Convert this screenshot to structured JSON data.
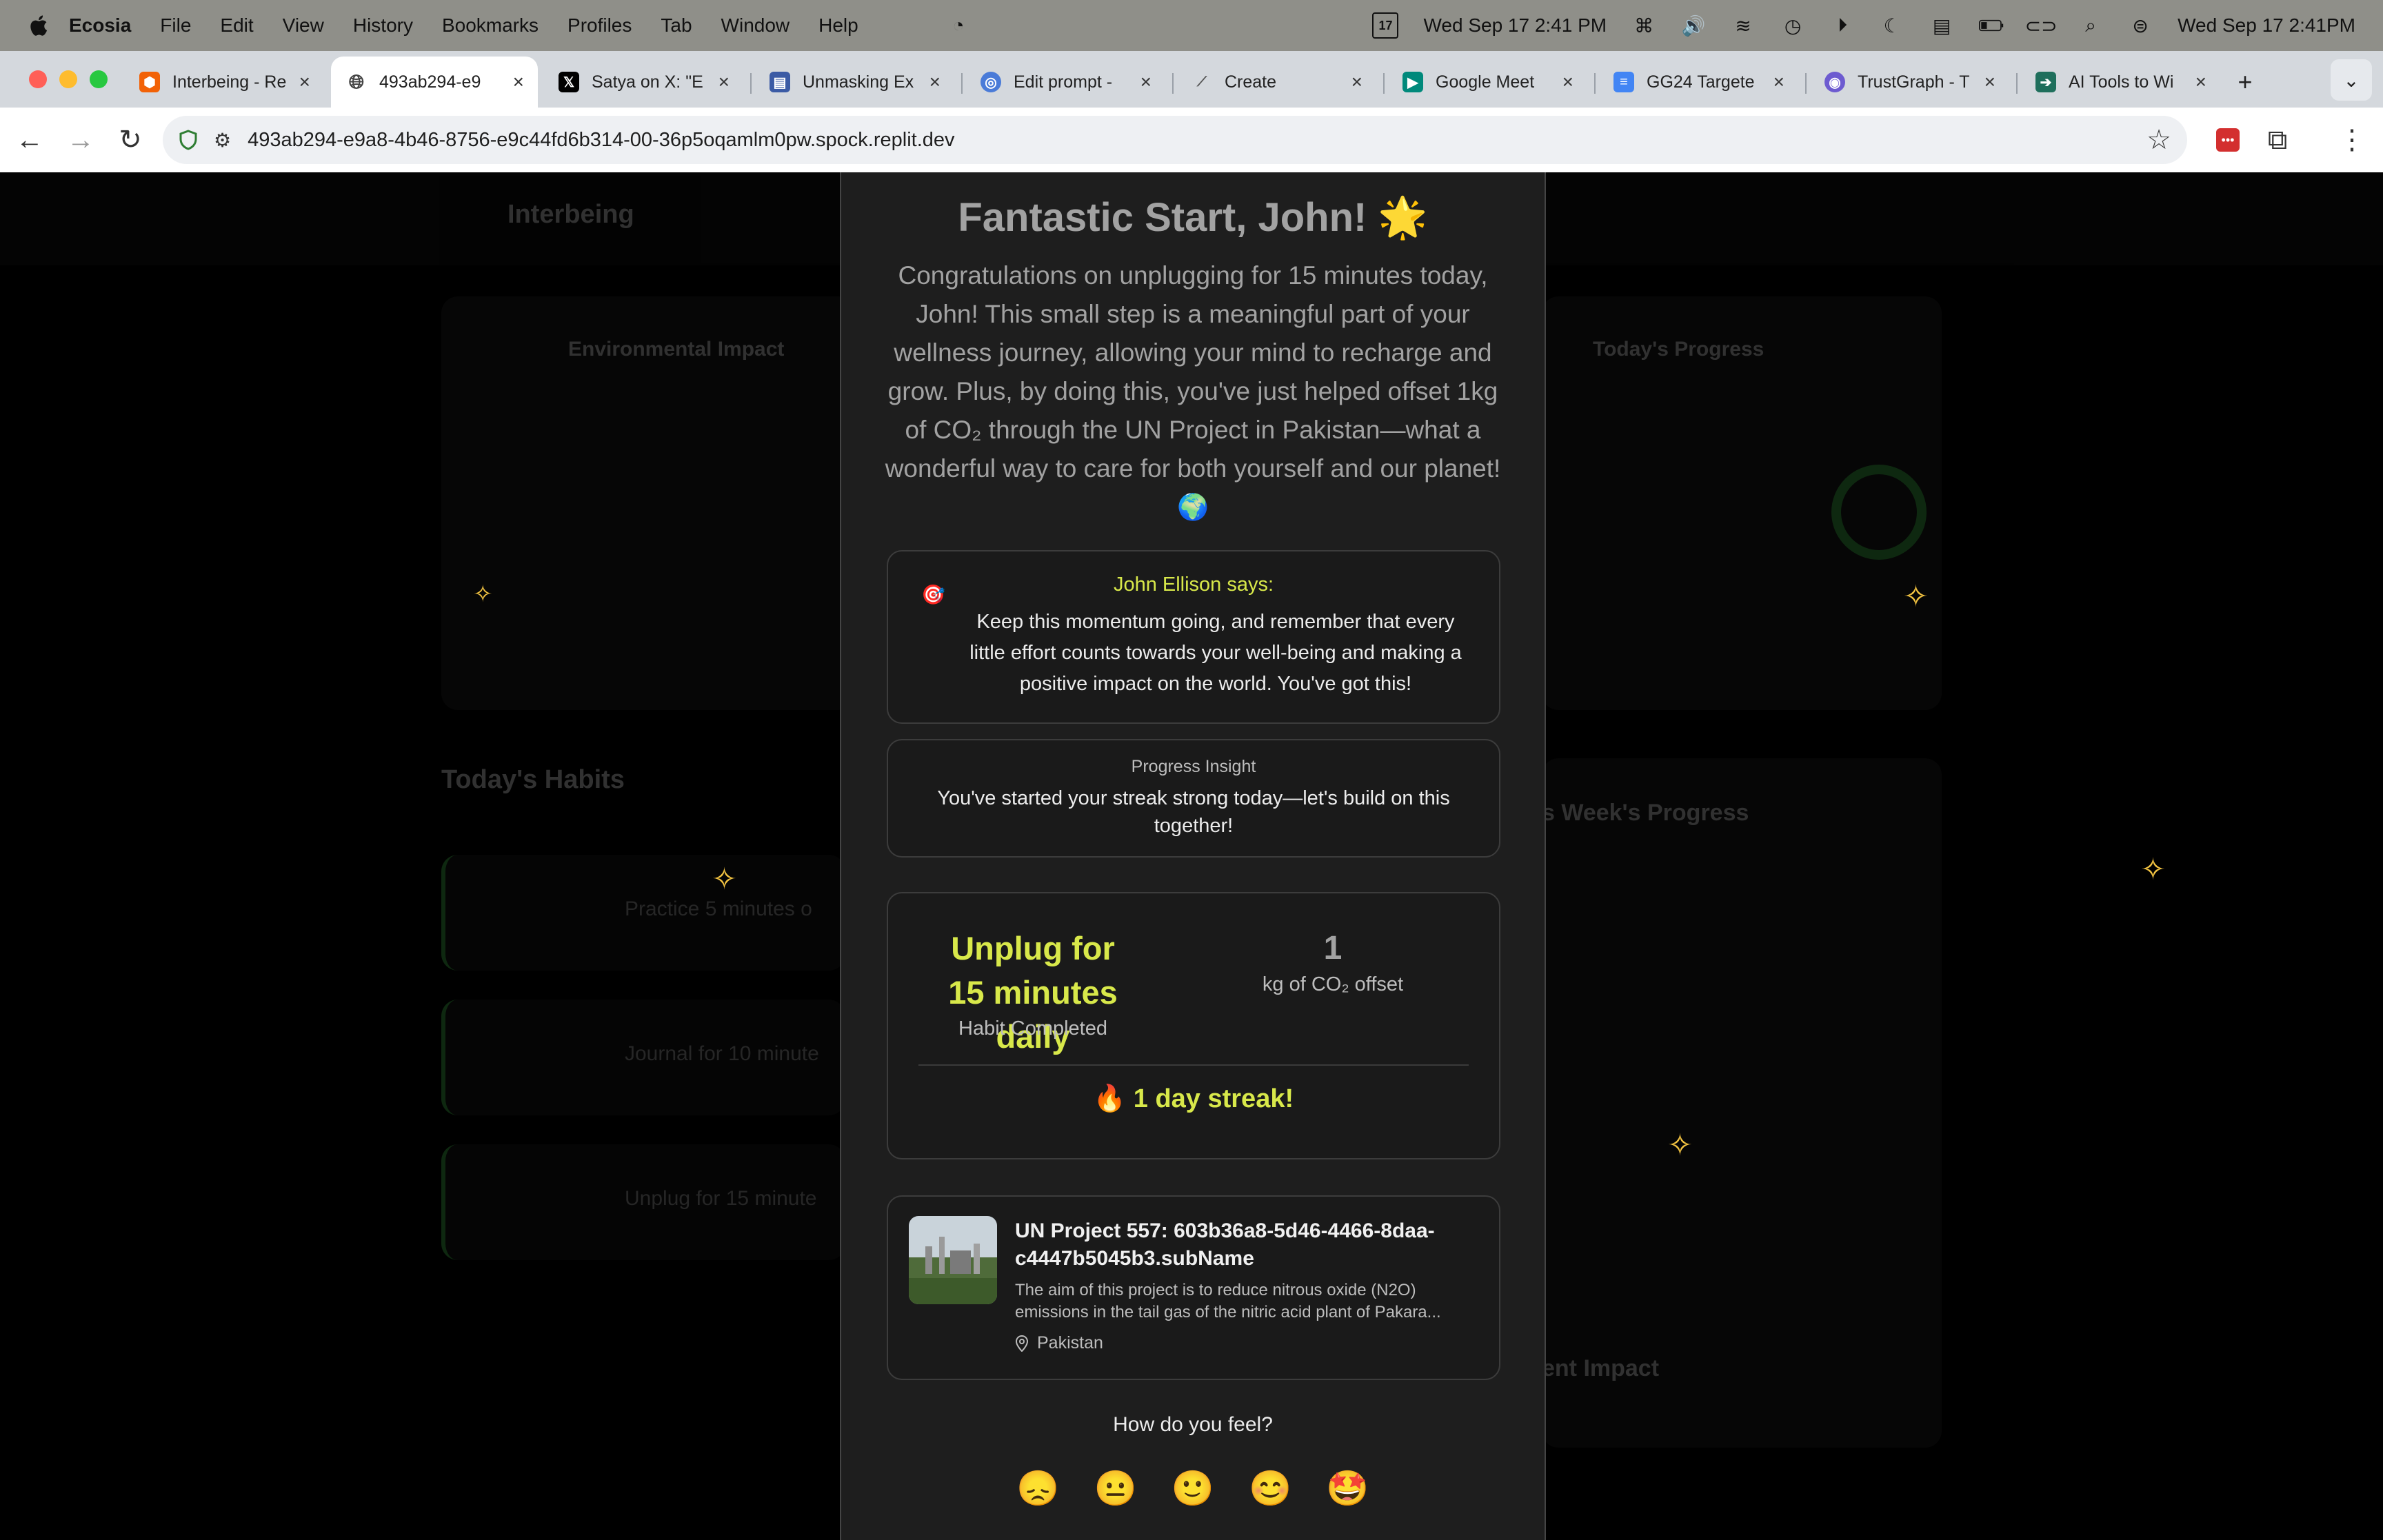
{
  "menubar": {
    "app_name": "Ecosia",
    "menus": [
      "File",
      "Edit",
      "View",
      "History",
      "Bookmarks",
      "Profiles",
      "Tab",
      "Window",
      "Help"
    ],
    "calendar_badge": "17",
    "date_time_primary": "Wed Sep 17  2:41 PM",
    "date_time_secondary": "Wed Sep 17  2:41PM"
  },
  "tabs": [
    {
      "title": "Interbeing - Re",
      "icon": "replit-icon",
      "color": "#f26207"
    },
    {
      "title": "493ab294-e9",
      "icon": "globe-icon",
      "color": "#444444",
      "active": true
    },
    {
      "title": "Satya on X: \"E",
      "icon": "x-logo-icon",
      "color": "#000000"
    },
    {
      "title": "Unmasking Ex",
      "icon": "doc-icon",
      "color": "#3b5ba5"
    },
    {
      "title": "Edit prompt - ",
      "icon": "chatbot-icon",
      "color": "#4a7bd8"
    },
    {
      "title": "Create",
      "icon": "wand-icon",
      "color": "#6b6b6b"
    },
    {
      "title": "Google Meet",
      "icon": "meet-icon",
      "color": "#00897b"
    },
    {
      "title": "GG24 Targete",
      "icon": "google-docs-icon",
      "color": "#4285f4"
    },
    {
      "title": "TrustGraph - T",
      "icon": "trustgraph-icon",
      "color": "#6d5bd0"
    },
    {
      "title": "AI Tools to Wi",
      "icon": "ai-tools-icon",
      "color": "#1f6f5c"
    }
  ],
  "address": {
    "url": "493ab294-e9a8-4b46-8756-e9c44fd6b314-00-36p5oqamlm0pw.spock.replit.dev"
  },
  "modal": {
    "title": "Fantastic Start, John! 🌟",
    "body": "Congratulations on unplugging for 15 minutes today, John! This small step is a meaningful part of your wellness journey, allowing your mind to recharge and grow. Plus, by doing this, you've just helped offset 1kg of CO₂ through the UN Project in Pakistan—what a wonderful way to care for both yourself and our planet! 🌍",
    "coach_icon": "🎯",
    "coach_name": "John Ellison says:",
    "coach_message": "Keep this momentum going, and remember that every little effort counts towards your well-being and making a positive impact on the world. You've got this!",
    "insight_label": "Progress Insight",
    "insight_text": "You've started your streak strong today—let's build on this together!",
    "habit_name": "Unplug for 15 minutes daily",
    "habit_sub": "Habit Completed",
    "co2_value": "1",
    "co2_label": "kg of CO₂ offset",
    "streak_icon": "🔥",
    "streak_text": "1 day streak!",
    "project_title": "UN Project 557: 603b36a8-5d46-4466-8daa-c4447b5045b3.subName",
    "project_desc": "The aim of this project is to reduce nitrous oxide (N2O) emissions in the tail gas of the nitric acid plant of Pakara...",
    "project_location": "Pakistan",
    "feel_question": "How do you feel?",
    "moods": [
      "😞",
      "😐",
      "🙂",
      "😊",
      "🤩"
    ]
  },
  "background": {
    "app_name": "Interbeing",
    "env_title": "Environmental Impact",
    "progress_title": "Today's Progress",
    "habits_title": "Today's Habits",
    "habit_items": [
      "Practice 5 minutes o",
      "Journal for 10 minute",
      "Unplug for 15 minute"
    ],
    "week_title": "s Week's Progress",
    "impact_title": "ent Impact"
  }
}
